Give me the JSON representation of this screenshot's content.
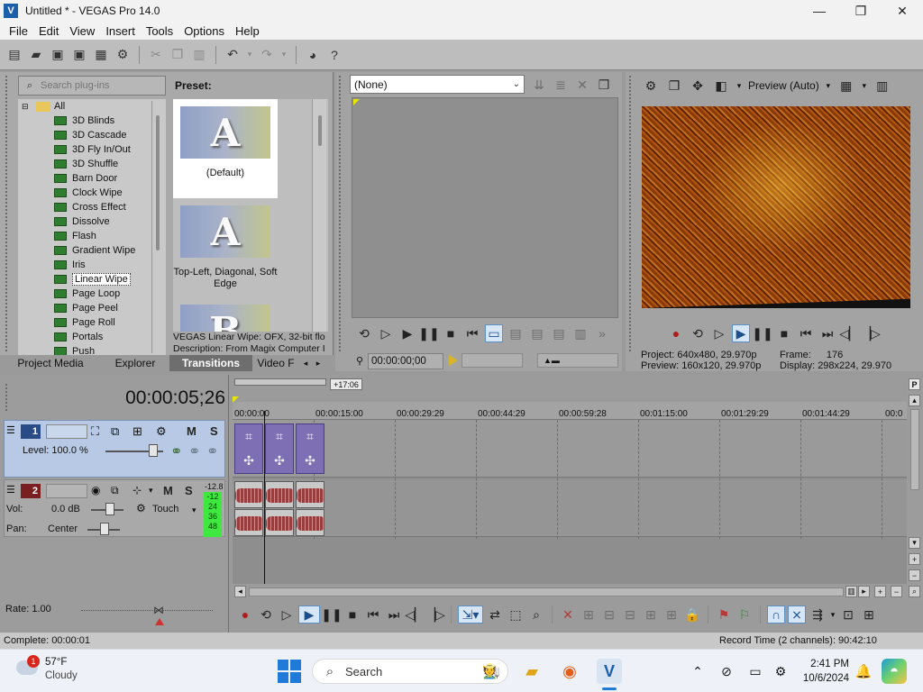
{
  "window": {
    "title": "Untitled * - VEGAS Pro 14.0",
    "controls": [
      "—",
      "❐",
      "✕"
    ]
  },
  "menu": [
    "File",
    "Edit",
    "View",
    "Insert",
    "Tools",
    "Options",
    "Help"
  ],
  "plugins": {
    "search_placeholder": "Search plug-ins",
    "tree_root": "All",
    "items": [
      "3D Blinds",
      "3D Cascade",
      "3D Fly In/Out",
      "3D Shuffle",
      "Barn Door",
      "Clock Wipe",
      "Cross Effect",
      "Dissolve",
      "Flash",
      "Gradient Wipe",
      "Iris",
      "Linear Wipe",
      "Page Loop",
      "Page Peel",
      "Page Roll",
      "Portals",
      "Push"
    ],
    "selected": "Linear Wipe"
  },
  "preset": {
    "label": "Preset:",
    "cards": [
      {
        "caption": "(Default)",
        "glyph": "A"
      },
      {
        "caption": "Top-Left, Diagonal, Soft Edge",
        "glyph": "A"
      },
      {
        "caption": "",
        "glyph": "B"
      }
    ],
    "description_line1": "VEGAS Linear Wipe: OFX, 32-bit flo",
    "description_line2": "Description: From Magix Computer I"
  },
  "tabs": [
    "Project Media",
    "Explorer",
    "Transitions",
    "Video F"
  ],
  "active_tab": "Transitions",
  "trimmer": {
    "select_value": "(None)",
    "timecode": "00:00:00;00"
  },
  "preview": {
    "mode": "Preview (Auto)",
    "project_label": "Project:",
    "project_value": "640x480, 29.970p",
    "preview_label": "Preview:",
    "preview_value": "160x120, 29.970p",
    "frame_label": "Frame:",
    "frame_value": "176",
    "display_label": "Display:",
    "display_value": "298x224, 29.970"
  },
  "timeline": {
    "timecode": "00:00:05;26",
    "loop_label": "+17:06",
    "ruler": [
      "00:00:00",
      "00:00:15:00",
      "00:00:29:29",
      "00:00:44:29",
      "00:00:59:28",
      "00:01:15:00",
      "00:01:29:29",
      "00:01:44:29",
      "00:0"
    ],
    "video_track": {
      "number": "1",
      "level_label": "Level: 100.0 %",
      "mute": "M",
      "solo": "S"
    },
    "audio_track": {
      "number": "2",
      "vol_label": "Vol:",
      "vol_value": "0.0 dB",
      "pan_label": "Pan:",
      "pan_value": "Center",
      "automation": "Touch",
      "mute": "M",
      "solo": "S",
      "meter_top": "-12.8",
      "meter_values": [
        "-12",
        "24",
        "36",
        "48"
      ]
    },
    "rate": "Rate: 1.00"
  },
  "status": {
    "left": "Complete: 00:00:01",
    "right": "Record Time (2 channels): 90:42:10"
  },
  "taskbar": {
    "weather_temp": "57°F",
    "weather_desc": "Cloudy",
    "badge": "1",
    "search": "Search",
    "time": "2:41 PM",
    "date": "10/6/2024"
  }
}
